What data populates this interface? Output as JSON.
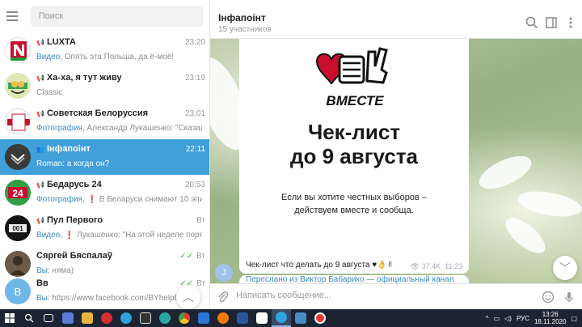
{
  "sidebar": {
    "search_placeholder": "Поиск",
    "chats": [
      {
        "title": "LUXTA",
        "time": "23:20",
        "prefix": "Видео,",
        "preview": " Опять эта Польша, да ё-моё!"
      },
      {
        "title": "Ха-ха, я тут живу",
        "time": "23:19",
        "prefix": "",
        "preview": "Classic"
      },
      {
        "title": "Советская Белоруссия",
        "time": "23:01",
        "prefix": "Фотография,",
        "preview": " Александр Лукашенко: \"Сказал не..."
      },
      {
        "title": "Інфапоінт",
        "time": "22:11",
        "prefix": "Roman:",
        "preview": " а когда он?"
      },
      {
        "title": "Бедарусь 24",
        "time": "20:53",
        "prefix": "Фотография,",
        "preview": " В Беларуси снимают 10 эпизод ..."
      },
      {
        "title": "Пул Первого",
        "time": "Вт",
        "prefix": "Видео,",
        "preview": " Лукашенко: \"На этой неделе порядок ..."
      },
      {
        "title": "Сяргей Бяспалаў",
        "time": "Вт",
        "prefix": "Вы:",
        "preview": " няма)"
      },
      {
        "title": "Вв",
        "time": "Вт",
        "prefix": "Вы:",
        "preview": " https://www.facebook.com/BYhelpBY/"
      }
    ]
  },
  "header": {
    "title": "Інфапоінт",
    "subtitle": "15 участников"
  },
  "message": {
    "logo_text": "ВМЕСТЕ",
    "headline_1": "Чек-лист",
    "headline_2": "до 9 августа",
    "invite_1": "Если вы хотите честных выборов –",
    "invite_2": "действуем вместе и сообща.",
    "caption": "Чек-лист что делать до 9 августа ♥👌✌",
    "views": "37.4K",
    "time": "11:23",
    "forwarded": "Переслано из Виктор Бабарико — официальный канал"
  },
  "join_avatar": "J",
  "composer": {
    "placeholder": "Написать сообщение..."
  },
  "taskbar": {
    "lang": "РУС",
    "time": "13:26",
    "date": "18.11.2020"
  }
}
